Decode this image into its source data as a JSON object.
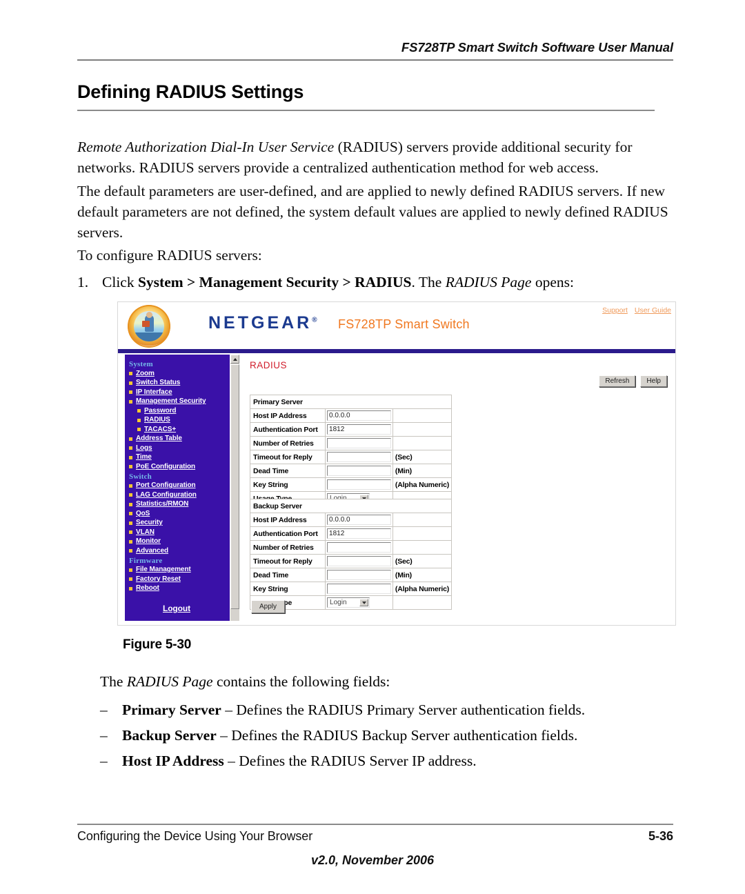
{
  "document": {
    "running_head": "FS728TP Smart Switch Software User Manual",
    "heading": "Defining RADIUS Settings",
    "paragraph1_italic": "Remote Authorization Dial-In User Service",
    "paragraph1_rest": " (RADIUS) servers provide additional security for networks. RADIUS servers provide a centralized authentication method for web access.",
    "paragraph2": "The default parameters are user-defined, and are applied to newly defined RADIUS servers. If new default parameters are not defined, the system default values are applied to newly defined RADIUS servers.",
    "paragraph3": "To configure RADIUS servers:",
    "step": {
      "number": "1.",
      "pre": "Click ",
      "bold_path": "System > Management Security > RADIUS",
      "mid": ". The ",
      "italic_page": "RADIUS Page",
      "post": " opens:"
    },
    "figure_caption": "Figure 5-30",
    "paragraph4_pre": "The ",
    "paragraph4_italic": "RADIUS Page",
    "paragraph4_post": " contains the following fields:",
    "bullets": [
      {
        "dash": "–",
        "term": "Primary Server",
        "desc": " – Defines the RADIUS Primary Server authentication fields."
      },
      {
        "dash": "–",
        "term": "Backup Server",
        "desc": " – Defines the RADIUS Backup Server authentication fields."
      },
      {
        "dash": "–",
        "term": "Host IP Address",
        "desc": " – Defines the RADIUS Server IP address."
      }
    ],
    "footer": {
      "left": "Configuring the Device Using Your Browser",
      "right": "5-36",
      "center": "v2.0, November 2006"
    }
  },
  "screenshot": {
    "header": {
      "brand": "NETGEAR",
      "brand_tm": "®",
      "model": "FS728TP Smart Switch",
      "links": [
        {
          "label": "Support"
        },
        {
          "label": "User Guide"
        }
      ]
    },
    "sidebar": {
      "sections": [
        {
          "title": "System",
          "items": [
            {
              "label": "Zoom",
              "sub": false
            },
            {
              "label": "Switch Status",
              "sub": false
            },
            {
              "label": "IP Interface",
              "sub": false
            },
            {
              "label": "Management Security",
              "sub": false
            },
            {
              "label": "Password",
              "sub": true
            },
            {
              "label": "RADIUS",
              "sub": true
            },
            {
              "label": "TACACS+",
              "sub": true
            },
            {
              "label": "Address Table",
              "sub": false
            },
            {
              "label": "Logs",
              "sub": false
            },
            {
              "label": "Time",
              "sub": false
            },
            {
              "label": "PoE Configuration",
              "sub": false
            }
          ]
        },
        {
          "title": "Switch",
          "items": [
            {
              "label": "Port Configuration",
              "sub": false
            },
            {
              "label": "LAG Configuration",
              "sub": false
            },
            {
              "label": "Statistics/RMON",
              "sub": false
            },
            {
              "label": "QoS",
              "sub": false
            },
            {
              "label": "Security",
              "sub": false
            },
            {
              "label": "VLAN",
              "sub": false
            },
            {
              "label": "Monitor",
              "sub": false
            },
            {
              "label": "Advanced",
              "sub": false
            }
          ]
        },
        {
          "title": "Firmware",
          "items": [
            {
              "label": "File Management",
              "sub": false
            },
            {
              "label": "Factory Reset",
              "sub": false
            },
            {
              "label": "Reboot",
              "sub": false
            }
          ]
        }
      ],
      "logout": "Logout"
    },
    "content": {
      "page_title": "RADIUS",
      "buttons": [
        {
          "label": "Refresh"
        },
        {
          "label": "Help"
        }
      ],
      "apply_label": "Apply",
      "primary": {
        "section_label": "Primary Server",
        "rows": [
          {
            "label": "Host IP Address",
            "value": "0.0.0.0",
            "unit": "",
            "type": "text"
          },
          {
            "label": "Authentication Port",
            "value": "1812",
            "unit": "",
            "type": "text"
          },
          {
            "label": "Number of Retries",
            "value": "",
            "unit": "",
            "type": "text"
          },
          {
            "label": "Timeout for Reply",
            "value": "",
            "unit": "(Sec)",
            "type": "text"
          },
          {
            "label": "Dead Time",
            "value": "",
            "unit": "(Min)",
            "type": "text"
          },
          {
            "label": "Key String",
            "value": "",
            "unit": "(Alpha Numeric)",
            "type": "text"
          },
          {
            "label": "Usage Type",
            "value": "Login",
            "unit": "",
            "type": "select"
          }
        ]
      },
      "backup": {
        "section_label": "Backup Server",
        "rows": [
          {
            "label": "Host IP Address",
            "value": "0.0.0.0",
            "unit": "",
            "type": "text"
          },
          {
            "label": "Authentication Port",
            "value": "1812",
            "unit": "",
            "type": "text"
          },
          {
            "label": "Number of Retries",
            "value": "",
            "unit": "",
            "type": "text"
          },
          {
            "label": "Timeout for Reply",
            "value": "",
            "unit": "(Sec)",
            "type": "text"
          },
          {
            "label": "Dead Time",
            "value": "",
            "unit": "(Min)",
            "type": "text"
          },
          {
            "label": "Key String",
            "value": "",
            "unit": "(Alpha Numeric)",
            "type": "text"
          },
          {
            "label": "Usage Type",
            "value": "Login",
            "unit": "",
            "type": "select"
          }
        ]
      }
    }
  },
  "colors": {
    "sidebar_bg": "#3a11a8",
    "navy_bar": "#2b1b8c",
    "brand_blue": "#1b3a8f",
    "model_orange": "#f07820",
    "title_red": "#d01b2a",
    "section_cyan": "#74b7e8",
    "bullet_gold": "#f2c733"
  }
}
